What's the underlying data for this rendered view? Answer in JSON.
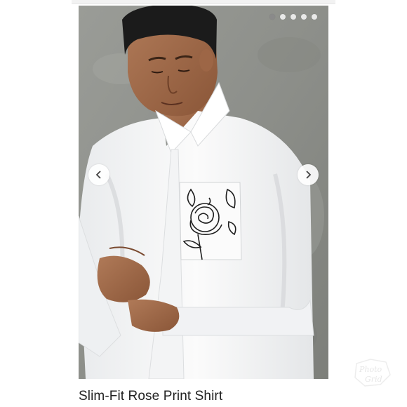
{
  "product": {
    "title": "Slim-Fit Rose Print Shirt"
  },
  "gallery": {
    "image_count": 5,
    "active_index": 0,
    "prev_icon": "chevron-left-icon",
    "next_icon": "chevron-right-icon"
  },
  "watermark": {
    "text": "Photo Grid"
  },
  "colors": {
    "background": "#ffffff",
    "title": "#222222",
    "dot_active": "#8a8a8a",
    "dot_inactive": "#eeeeee"
  }
}
